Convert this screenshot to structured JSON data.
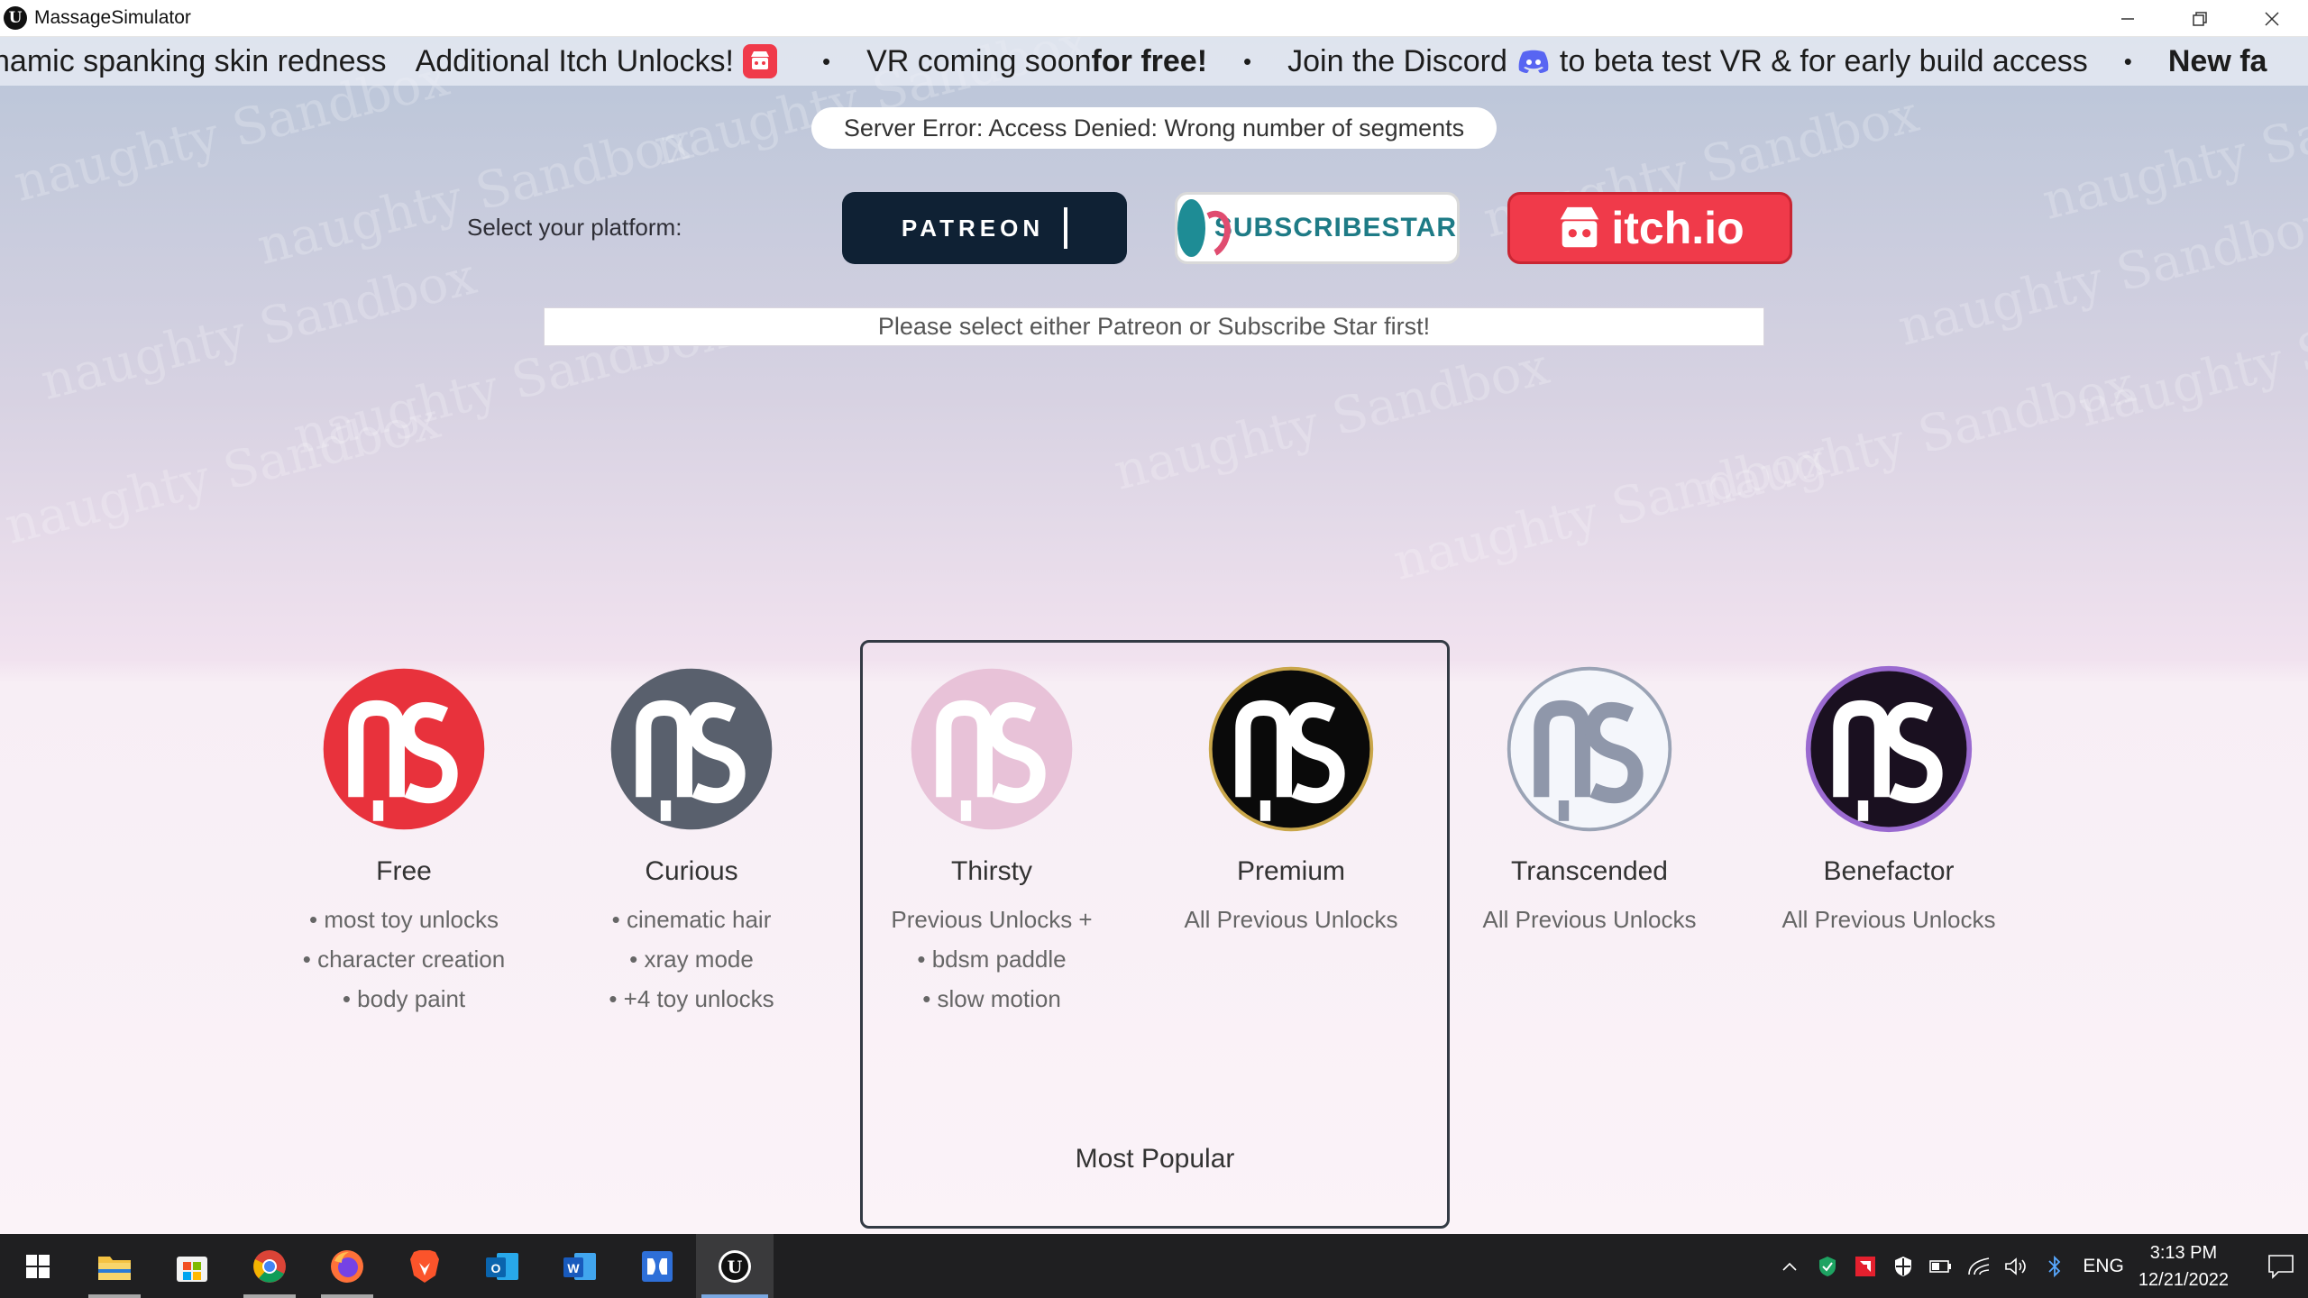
{
  "window": {
    "title": "MassageSimulator"
  },
  "ticker": {
    "item1": "namic spanking skin redness",
    "item2": "Additional Itch Unlocks!",
    "item3_a": "VR coming soon ",
    "item3_b": "for free!",
    "item4_a": "Join the Discord",
    "item4_b": "to beta test VR & for early build access",
    "item5": "New fa",
    "separator": "•"
  },
  "error": {
    "message": "Server Error: Access Denied: Wrong number of segments"
  },
  "platform": {
    "label": "Select your platform:",
    "patreon": "PATREON",
    "subscribestar": "SUBSCRIBESTAR",
    "itchio": "itch.io"
  },
  "hint": "Please select either Patreon or Subscribe Star first!",
  "tiers": [
    {
      "name": "Free",
      "features": [
        "• most toy unlocks",
        "• character creation",
        "• body paint"
      ],
      "color": "#e8323c"
    },
    {
      "name": "Curious",
      "features": [
        "• cinematic hair",
        "• xray mode",
        "• +4 toy unlocks"
      ],
      "color": "#59606d"
    },
    {
      "name": "Thirsty",
      "features": [
        "Previous Unlocks +",
        "• bdsm paddle",
        "• slow motion"
      ],
      "color": "#e8c2d8"
    },
    {
      "name": "Premium",
      "features": [
        "All Previous Unlocks"
      ],
      "color": "#0a0a0a"
    },
    {
      "name": "Transcended",
      "features": [
        "All Previous Unlocks"
      ],
      "color": "#f4f6fb"
    },
    {
      "name": "Benefactor",
      "features": [
        "All Previous Unlocks"
      ],
      "color": "#1a1020"
    }
  ],
  "most_popular": "Most Popular",
  "watermark": "naughty Sandbox",
  "taskbar": {
    "language": "ENG",
    "time": "3:13 PM",
    "date": "12/21/2022"
  }
}
